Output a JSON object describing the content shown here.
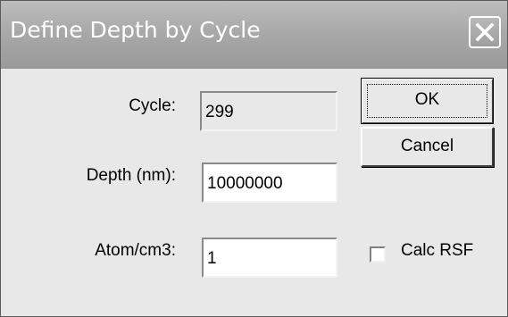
{
  "window": {
    "title": "Define Depth by Cycle"
  },
  "form": {
    "cycle_label": "Cycle:",
    "cycle_value": "299",
    "depth_label": "Depth (nm):",
    "depth_value": "10000000",
    "atom_label": "Atom/cm3:",
    "atom_value": "1"
  },
  "buttons": {
    "ok_label": "OK",
    "cancel_label": "Cancel"
  },
  "options": {
    "calc_rsf_label": "Calc RSF",
    "calc_rsf_checked": false
  },
  "icons": {
    "close": "close-icon"
  }
}
